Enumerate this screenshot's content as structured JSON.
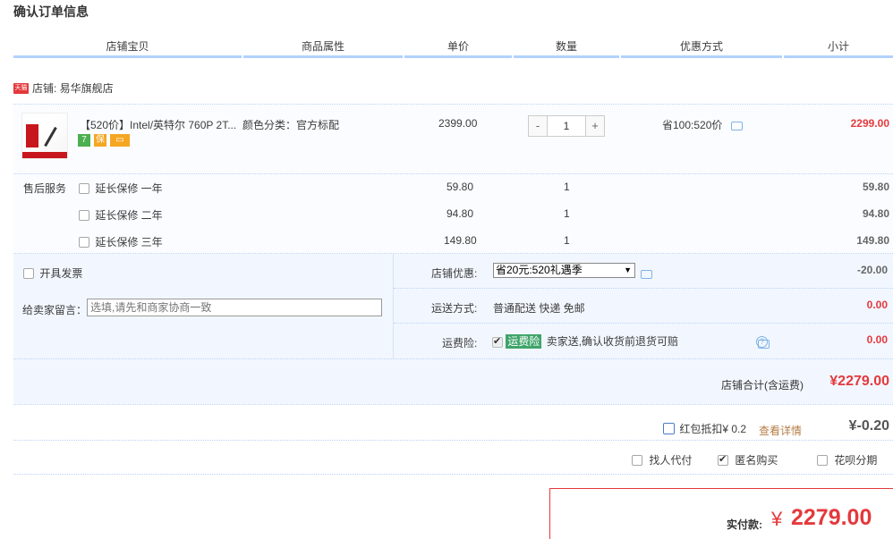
{
  "page": {
    "title": "确认订单信息"
  },
  "columns": [
    "店铺宝贝",
    "商品属性",
    "单价",
    "数量",
    "优惠方式",
    "小计"
  ],
  "shop": {
    "badge": "天猫",
    "label": "店铺: 易华旗舰店"
  },
  "item": {
    "title": "【520价】Intel/英特尔 760P 2T...",
    "attribute": "颜色分类：官方标配",
    "unit_price": "2399.00",
    "quantity": "1",
    "qty_minus": "-",
    "qty_plus": "+",
    "discount": "省100:520价",
    "subtotal": "2299.00",
    "service_icons": [
      {
        "name": "7day-return-icon",
        "glyph": "7",
        "color": "#4caf50"
      },
      {
        "name": "guarantee-icon",
        "glyph": "保",
        "color": "#f5a623"
      },
      {
        "name": "credit-card-icon",
        "glyph": "▭",
        "color": "#f5a623"
      }
    ]
  },
  "after_sales": {
    "label": "售后服务",
    "options": [
      {
        "label": "延长保修 一年",
        "price": "59.80",
        "qty": "1",
        "subtotal": "59.80"
      },
      {
        "label": "延长保修 二年",
        "price": "94.80",
        "qty": "1",
        "subtotal": "94.80"
      },
      {
        "label": "延长保修 三年",
        "price": "149.80",
        "qty": "1",
        "subtotal": "149.80"
      }
    ]
  },
  "invoice": {
    "label": "开具发票"
  },
  "message": {
    "label": "给卖家留言：",
    "placeholder": "选填,请先和商家协商一致"
  },
  "shop_discount": {
    "label": "店铺优惠:",
    "selected": "省20元:520礼遇季",
    "amount": "-20.00"
  },
  "shipping": {
    "label": "运送方式:",
    "value": "普通配送 快递 免邮",
    "amount": "0.00"
  },
  "freight_insurance": {
    "label": "运费险:",
    "tag": "运费险",
    "desc": "卖家送,确认收货前退货可赔",
    "amount": "0.00"
  },
  "shop_total": {
    "label": "店铺合计(含运费)",
    "amount": "¥2279.00"
  },
  "red_packet": {
    "label": "红包抵扣¥ 0.2",
    "link": "查看详情",
    "amount": "¥-0.20"
  },
  "options": {
    "proxy_pay": "找人代付",
    "anonymous": "匿名购买",
    "huabei": "花呗分期"
  },
  "pay": {
    "label": "实付款:",
    "currency": "¥",
    "amount": "2279.00"
  },
  "colors": {
    "accent_red": "#e4393c",
    "header_line": "#b2d1ff",
    "tag_green": "#3fa46a"
  }
}
